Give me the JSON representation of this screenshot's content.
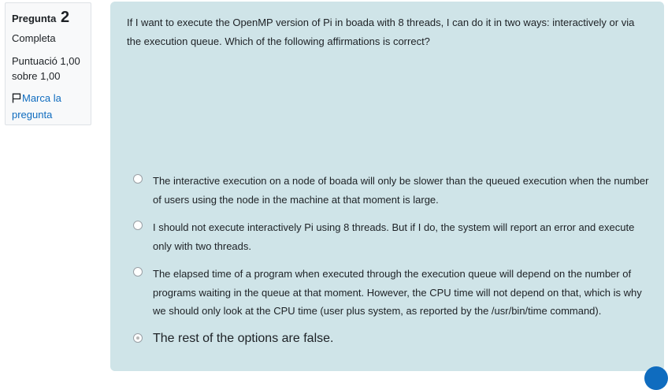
{
  "question_info": {
    "number_label": "Pregunta",
    "number": "2",
    "state": "Completa",
    "grade": "Puntuació 1,00 sobre 1,00",
    "flag_label": "Marca la pregunta"
  },
  "question": {
    "text": "If I want to execute the OpenMP version of Pi in boada with 8 threads, I can do it in two ways: interactively or via the execution queue. Which of the following affirmations is correct?",
    "answers": [
      {
        "label": "The interactive execution on a node of boada will only be slower than the queued execution when the number of users using the node in the machine at that moment is large.",
        "selected": false
      },
      {
        "label": "I should not execute interactively Pi using 8 threads. But if I do, the system will report an error and execute only with two threads.",
        "selected": false
      },
      {
        "label": "The elapsed time of a program when executed through the execution queue will depend on the number of programs waiting in the queue at that moment. However, the CPU time will not depend on that, which is why we should only look at the CPU time (user plus system, as reported by the /usr/bin/time command).",
        "selected": false
      },
      {
        "label": "The rest of the options are false.",
        "selected": true
      }
    ]
  },
  "colors": {
    "content_background": "#cfe4e8",
    "link": "#0f6cbf",
    "info_background": "#f8f9fa"
  }
}
